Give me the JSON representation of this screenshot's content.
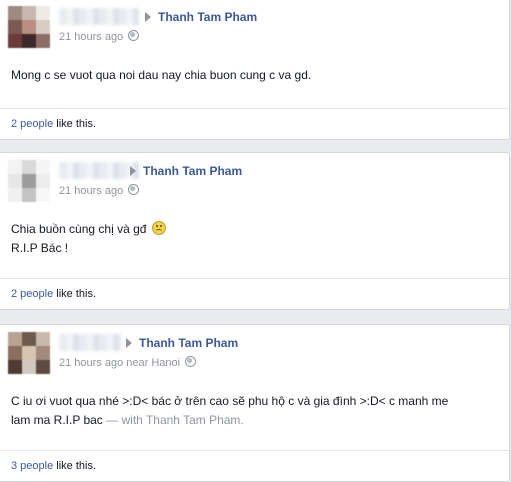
{
  "posts": [
    {
      "target_name": "Thanh Tam Pham",
      "time": "21 hours ago",
      "location": "",
      "body_lines": [
        "Mong c se vuot qua noi dau nay chia buon cung c va gd."
      ],
      "likes": {
        "count_text": "2 people",
        "suffix": " like this."
      }
    },
    {
      "target_name": "Thanh Tam Pham",
      "time": "21 hours ago",
      "location": "",
      "body_lines": [
        "Chia buồn cùng chị và gđ",
        "R.I.P Bác !"
      ],
      "emoji": "sad-face-icon",
      "likes": {
        "count_text": "2 people",
        "suffix": " like this."
      }
    },
    {
      "target_name": "Thanh Tam Pham",
      "time": "21 hours ago",
      "location": "near Hanoi",
      "body_lines": [
        "C iu ơi vuot qua nhé >:D< bác ở trên cao sẽ phu hộ c và gia đình >:D< c manh me",
        "lam ma R.I.P bac"
      ],
      "with_prefix": " — with ",
      "with_name": "Thanh Tam Pham.",
      "likes": {
        "count_text": "3 people",
        "suffix": " like this."
      }
    }
  ],
  "colors": {
    "link": "#3b5998",
    "meta": "#90949c",
    "background": "#e9ebee"
  }
}
